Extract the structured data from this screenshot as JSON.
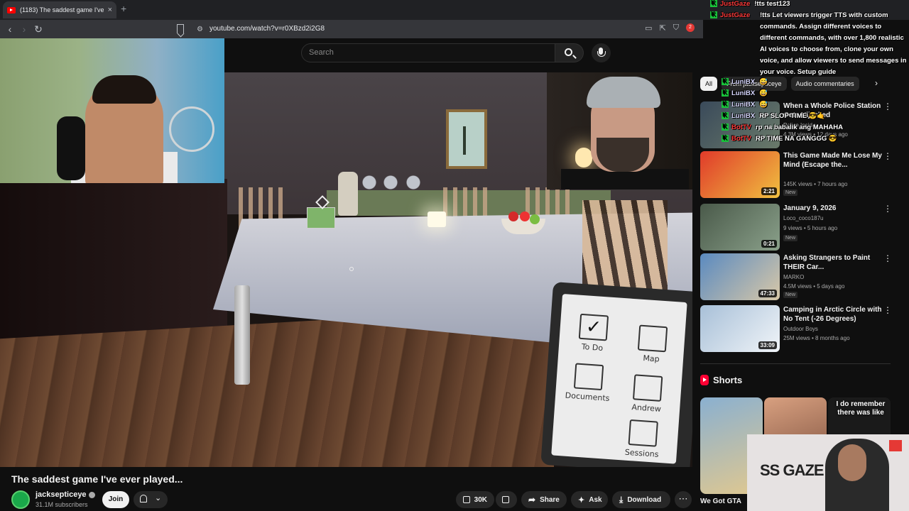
{
  "browser": {
    "tab_title": "(1183) The saddest game I've ev",
    "tab_close": "×",
    "new_tab": "+",
    "back": "‹",
    "forward": "›",
    "reload": "↻",
    "url": "youtube.com/watch?v=r0XBzd2i2G8",
    "extension_badge": "2"
  },
  "header": {
    "search_placeholder": "Search"
  },
  "video": {
    "title": "The saddest game I've ever played...",
    "tablet_apps": [
      "To Do",
      "Map",
      "Documents",
      "Andrew",
      "Sessions"
    ],
    "gaze_logo": "SS GAZE"
  },
  "channel": {
    "name": "jacksepticeye",
    "subscribers": "31.1M subscribers",
    "join_label": "Join"
  },
  "actions": {
    "likes": "30K",
    "share_label": "Share",
    "ask_label": "Ask",
    "download_label": "Download",
    "more_label": "⋯"
  },
  "chips": {
    "items": [
      "All",
      "From jacksepticeye",
      "Audio commentaries"
    ],
    "next": "›"
  },
  "recommendations": [
    {
      "title": "When a Whole Police Station Gets Hijacked",
      "channel": "Police Insider",
      "meta": "4.3M views • 12 days ago",
      "duration": "",
      "badge": ""
    },
    {
      "title": "This Game Made Me Lose My Mind (Escape the...",
      "channel": "",
      "meta": "145K views • 7 hours ago",
      "duration": "2:21",
      "badge": "New"
    },
    {
      "title": "January 9, 2026",
      "channel": "Loco_coco187u",
      "meta": "9 views • 5 hours ago",
      "duration": "0:21",
      "badge": "New"
    },
    {
      "title": "Asking Strangers to Paint THEIR Car...",
      "channel": "MARKO",
      "meta": "4.5M views • 5 days ago",
      "duration": "47:33",
      "badge": "New"
    },
    {
      "title": "Camping in Arctic Circle with No Tent (-26 Degrees)",
      "channel": "Outdoor Boys",
      "meta": "25M views • 8 months ago",
      "duration": "33:09",
      "badge": ""
    }
  ],
  "shorts": {
    "label": "Shorts",
    "first_title": "We Got GTA",
    "overlay_text": "I do remember there was like"
  },
  "chat": {
    "lines": [
      {
        "user": "JustGaze",
        "msg": "!tts test123"
      },
      {
        "user": "JustGaze",
        "msg": ""
      }
    ],
    "wrapped_msg": "!tts Let viewers trigger TTS with custom commands. Assign different voices to different commands, with over 1,800 realistic AI voices to choose from, clone your own voice, and allow viewers to send messages in your voice. Setup guide",
    "lines2": [
      {
        "user": "LuniBX",
        "msg": "😅"
      },
      {
        "user": "LuniBX",
        "msg": "😅"
      },
      {
        "user": "LuniBX",
        "msg": "😅"
      },
      {
        "user": "LuniBX",
        "msg": "RP SLOP TIME 😎🤙"
      },
      {
        "user": "BotTV",
        "msg": "rp na babalik ang MAHAHA"
      },
      {
        "user": "BotTV",
        "msg": "RP TIME NA GANGGG 😎"
      }
    ]
  }
}
